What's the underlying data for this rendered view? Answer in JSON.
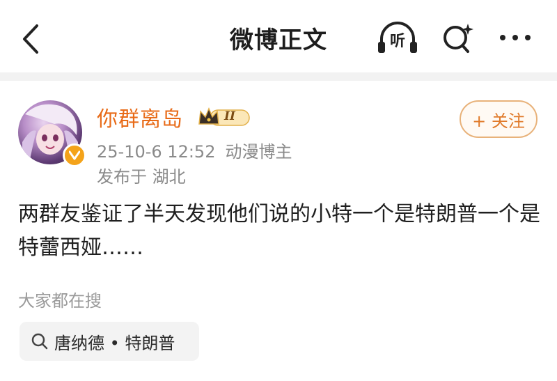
{
  "header": {
    "title": "微博正文",
    "listen_label": "听"
  },
  "post": {
    "author": "你群离岛",
    "vip_level": "II",
    "timestamp": "25-10-6 12:52",
    "author_role": "动漫博主",
    "location": "发布于 湖北",
    "follow_label": "+ 关注",
    "text": "两群友鉴证了半天发现他们说的小特一个是特朗普一个是特蕾西娅……"
  },
  "related": {
    "section_title": "大家都在搜",
    "chips": [
      {
        "label": "唐纳德 • 特朗普"
      }
    ]
  },
  "colors": {
    "accent_orange": "#e86b18",
    "badge_gold": "#f4a31a",
    "meta_gray": "#8a8a8a"
  }
}
